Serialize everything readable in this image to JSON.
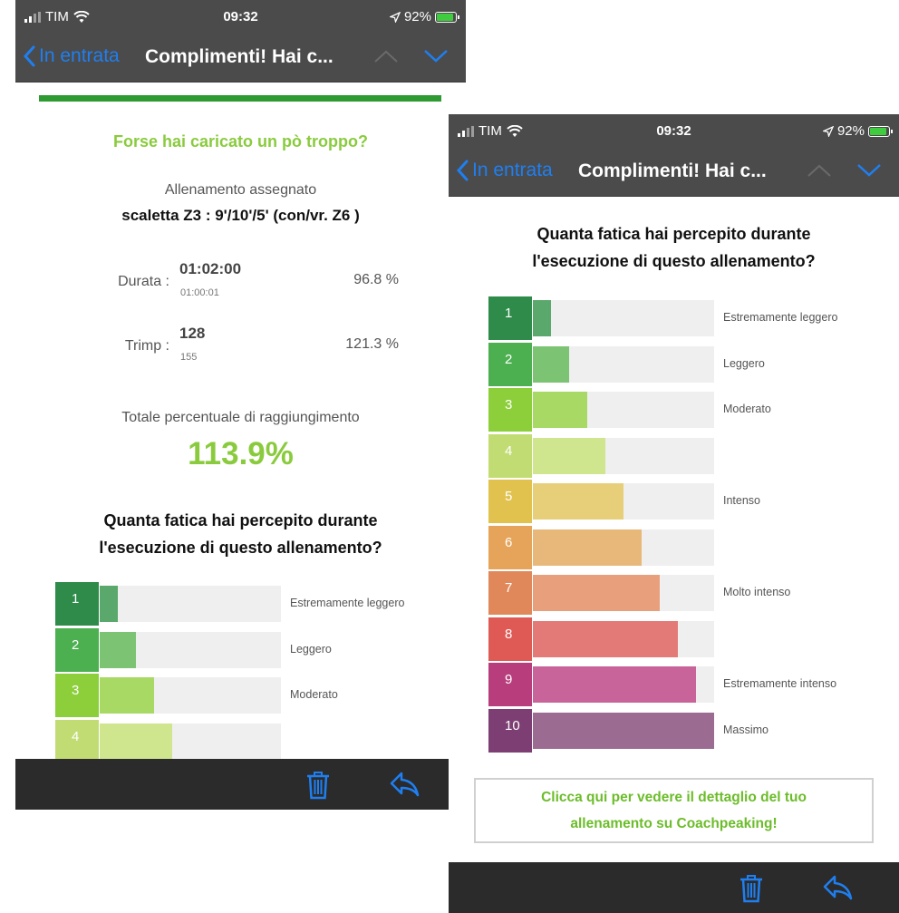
{
  "screens": [
    {
      "status": {
        "carrier": "TIM",
        "time": "09:32",
        "battery": "92%"
      },
      "nav": {
        "back_label": "In entrata",
        "subject": "Complimenti! Hai c..."
      },
      "header_rule_color": "#2e9a32",
      "warning": "Forse hai caricato un pò troppo?",
      "assigned_label": "Allenamento assegnato",
      "workout_name": "scaletta Z3 : 9'/10'/5' (con/vr. Z6 )",
      "metrics": [
        {
          "label": "Durata :",
          "value": "01:02:00",
          "target": "01:00:01",
          "percent": "96.8 %"
        },
        {
          "label": "Trimp :",
          "value": "128",
          "target": "155",
          "percent": "121.3 %"
        }
      ],
      "total_label": "Totale percentuale di raggiungimento",
      "total_value": "113.9%",
      "question_line1": "Quanta fatica hai percepito durante",
      "question_line2": "l'esecuzione di questo allenamento?",
      "scale": [
        {
          "num": "1",
          "label": "Estremamente leggero",
          "fill": 0.1
        },
        {
          "num": "2",
          "label": "Leggero",
          "fill": 0.2
        },
        {
          "num": "3",
          "label": "Moderato",
          "fill": 0.3
        },
        {
          "num": "4",
          "label": "",
          "fill": 0.4
        }
      ],
      "toolbar": {
        "trash_icon": "trash-icon",
        "reply_icon": "reply-icon"
      }
    },
    {
      "status": {
        "carrier": "TIM",
        "time": "09:32",
        "battery": "92%"
      },
      "nav": {
        "back_label": "In entrata",
        "subject": "Complimenti! Hai c..."
      },
      "question_line1": "Quanta fatica hai percepito durante",
      "question_line2": "l'esecuzione di questo allenamento?",
      "scale": [
        {
          "num": "1",
          "label": "Estremamente leggero",
          "fill": 0.1
        },
        {
          "num": "2",
          "label": "Leggero",
          "fill": 0.2
        },
        {
          "num": "3",
          "label": "Moderato",
          "fill": 0.3
        },
        {
          "num": "4",
          "label": "",
          "fill": 0.4
        },
        {
          "num": "5",
          "label": "Intenso",
          "fill": 0.5
        },
        {
          "num": "6",
          "label": "",
          "fill": 0.6
        },
        {
          "num": "7",
          "label": "Molto intenso",
          "fill": 0.7
        },
        {
          "num": "8",
          "label": "",
          "fill": 0.8
        },
        {
          "num": "9",
          "label": "Estremamente intenso",
          "fill": 0.9
        },
        {
          "num": "10",
          "label": "Massimo",
          "fill": 1.0
        }
      ],
      "cta_line1": "Clicca qui per vedere il dettaglio del tuo",
      "cta_line2": "allenamento su Coachpeaking!",
      "toolbar": {
        "trash_icon": "trash-icon",
        "reply_icon": "reply-icon"
      }
    }
  ],
  "colors": {
    "ios_blue": "#1f7ff0",
    "accent_green": "#8acb3e",
    "scale_badges": [
      "#2e8b4a",
      "#4caf50",
      "#8ccf3a",
      "#c2dc74",
      "#e2c24e",
      "#e5a45a",
      "#e0885a",
      "#e05a55",
      "#b83d7c",
      "#7d3f73"
    ],
    "scale_fills": [
      "#5aa86c",
      "#7cc474",
      "#a7d964",
      "#cfe58e",
      "#e6cf78",
      "#e8b87a",
      "#e8a07c",
      "#e47a78",
      "#c8649a",
      "#9b6b92"
    ]
  }
}
